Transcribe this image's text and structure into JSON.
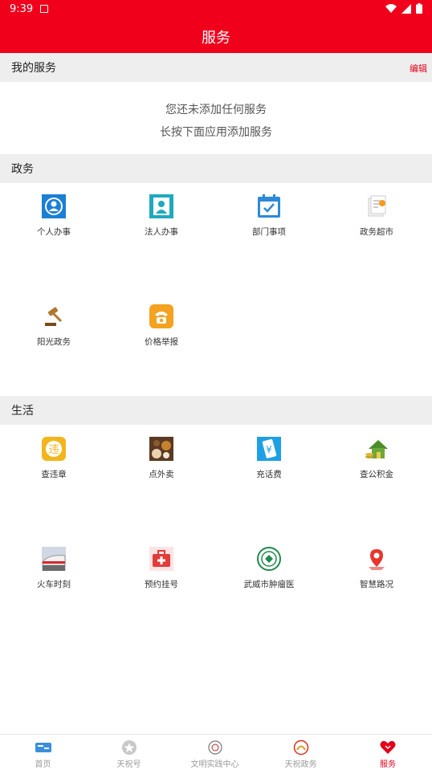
{
  "status": {
    "time": "9:39"
  },
  "header": {
    "title": "服务"
  },
  "my_services": {
    "title": "我的服务",
    "edit_label": "编辑",
    "empty_line1": "您还未添加任何服务",
    "empty_line2": "长按下面应用添加服务"
  },
  "gov": {
    "title": "政务",
    "items": [
      {
        "label": "个人办事",
        "icon": "person-icon"
      },
      {
        "label": "法人办事",
        "icon": "portrait-icon"
      },
      {
        "label": "部门事项",
        "icon": "calendar-check-icon"
      },
      {
        "label": "政务超市",
        "icon": "document-stack-icon"
      },
      {
        "label": "阳光政务",
        "icon": "gavel-icon"
      },
      {
        "label": "价格举报",
        "icon": "phone-icon"
      }
    ]
  },
  "life": {
    "title": "生活",
    "items": [
      {
        "label": "查违章",
        "icon": "violation-icon"
      },
      {
        "label": "点外卖",
        "icon": "food-icon"
      },
      {
        "label": "充话费",
        "icon": "mobile-yuan-icon"
      },
      {
        "label": "查公积金",
        "icon": "house-coins-icon"
      },
      {
        "label": "火车时刻",
        "icon": "train-icon"
      },
      {
        "label": "预约挂号",
        "icon": "medical-kit-icon"
      },
      {
        "label": "武威市肿瘤医",
        "icon": "hospital-logo-icon"
      },
      {
        "label": "智慧路况",
        "icon": "map-pin-icon"
      }
    ]
  },
  "tabs": [
    {
      "label": "首页",
      "icon": "home-icon",
      "active": false
    },
    {
      "label": "天祝号",
      "icon": "star-icon",
      "active": false
    },
    {
      "label": "文明实践中心",
      "icon": "emblem-icon",
      "active": false
    },
    {
      "label": "天祝政务",
      "icon": "gov-logo-icon",
      "active": false
    },
    {
      "label": "服务",
      "icon": "heart-icon",
      "active": true
    }
  ],
  "colors": {
    "brand": "#f1001c",
    "accent": "#e4001b",
    "section_bg": "#eeeeee"
  }
}
